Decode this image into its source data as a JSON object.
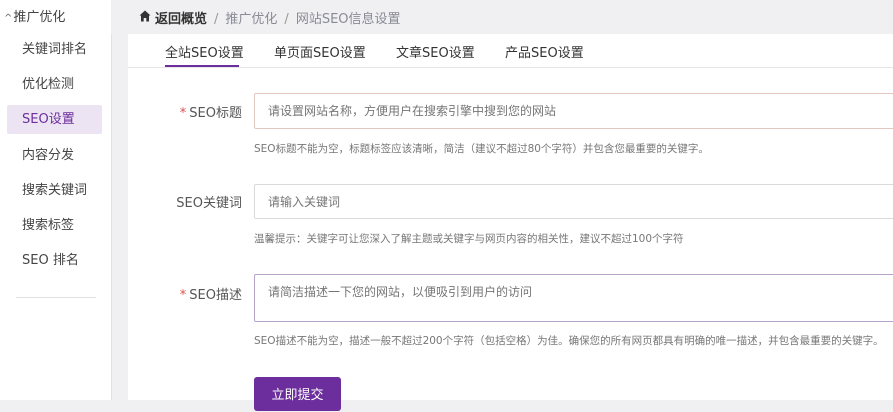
{
  "sidebar": {
    "group_title": "推广优化",
    "items": [
      {
        "label": "关键词排名"
      },
      {
        "label": "优化检测"
      },
      {
        "label": "SEO设置"
      },
      {
        "label": "内容分发"
      },
      {
        "label": "搜索关键词"
      },
      {
        "label": "搜索标签"
      },
      {
        "label": "SEO 排名"
      }
    ],
    "active_index": 2
  },
  "breadcrumb": {
    "back": "返回概览",
    "separator": "/",
    "level1": "推广优化",
    "level2": "网站SEO信息设置"
  },
  "tabs": [
    {
      "label": "全站SEO设置"
    },
    {
      "label": "单页面SEO设置"
    },
    {
      "label": "文章SEO设置"
    },
    {
      "label": "产品SEO设置"
    }
  ],
  "form": {
    "required_mark": "*",
    "title_label": "SEO标题",
    "title_placeholder": "请设置网站名称，方便用户在搜索引擎中搜到您的网站",
    "title_hint": "SEO标题不能为空，标题标签应该清晰，简洁（建议不超过80个字符）并包含您最重要的关键字。",
    "keywords_label": "SEO关键词",
    "keywords_placeholder": "请输入关键词",
    "keywords_hint": "温馨提示：关键字可让您深入了解主题或关键字与网页内容的相关性，建议不超过100个字符",
    "desc_label": "SEO描述",
    "desc_placeholder": "请简洁描述一下您的网站，以便吸引到用户的访问",
    "desc_hint": "SEO描述不能为空，描述一般不超过200个字符（包括空格）为佳。确保您的所有网页都具有明确的唯一描述，并包含最重要的关键字。",
    "submit_label": "立即提交"
  },
  "colors": {
    "accent": "#6c2e9c",
    "active_bg": "#ece4f3",
    "required": "#d9534f"
  }
}
